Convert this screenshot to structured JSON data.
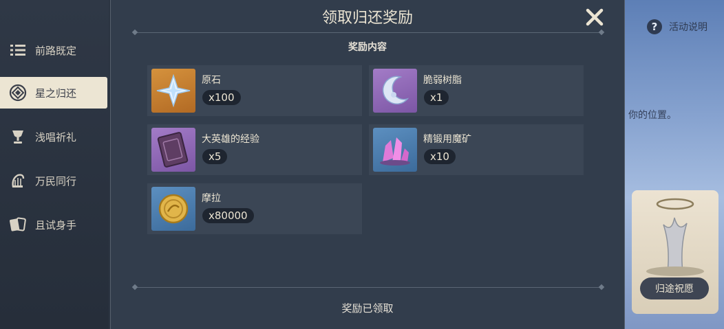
{
  "sidebar": {
    "items": [
      {
        "label": "前路既定",
        "icon": "list-icon"
      },
      {
        "label": "星之归还",
        "icon": "star-return-icon",
        "active": true
      },
      {
        "label": "浅唱祈礼",
        "icon": "chalice-icon"
      },
      {
        "label": "万民同行",
        "icon": "harp-icon"
      },
      {
        "label": "且试身手",
        "icon": "cards-icon"
      }
    ]
  },
  "dialog": {
    "title": "领取归还奖励",
    "section_title": "奖励内容",
    "footer": "奖励已领取",
    "rewards": [
      {
        "name": "原石",
        "qty": "x100",
        "icon": "primogem-icon",
        "rarity_color": "#c98534"
      },
      {
        "name": "脆弱树脂",
        "qty": "x1",
        "icon": "fragile-resin-icon",
        "rarity_color": "#9a74c0"
      },
      {
        "name": "大英雄的经验",
        "qty": "x5",
        "icon": "heros-wit-icon",
        "rarity_color": "#9a74c0"
      },
      {
        "name": "精锻用魔矿",
        "qty": "x10",
        "icon": "mystic-ore-icon",
        "rarity_color": "#4f84b8"
      },
      {
        "name": "摩拉",
        "qty": "x80000",
        "icon": "mora-icon",
        "rarity_color": "#4f84b8"
      }
    ]
  },
  "background": {
    "help_label": "活动说明",
    "partial_text": "你的位置。",
    "wish_button": "归途祝愿"
  }
}
